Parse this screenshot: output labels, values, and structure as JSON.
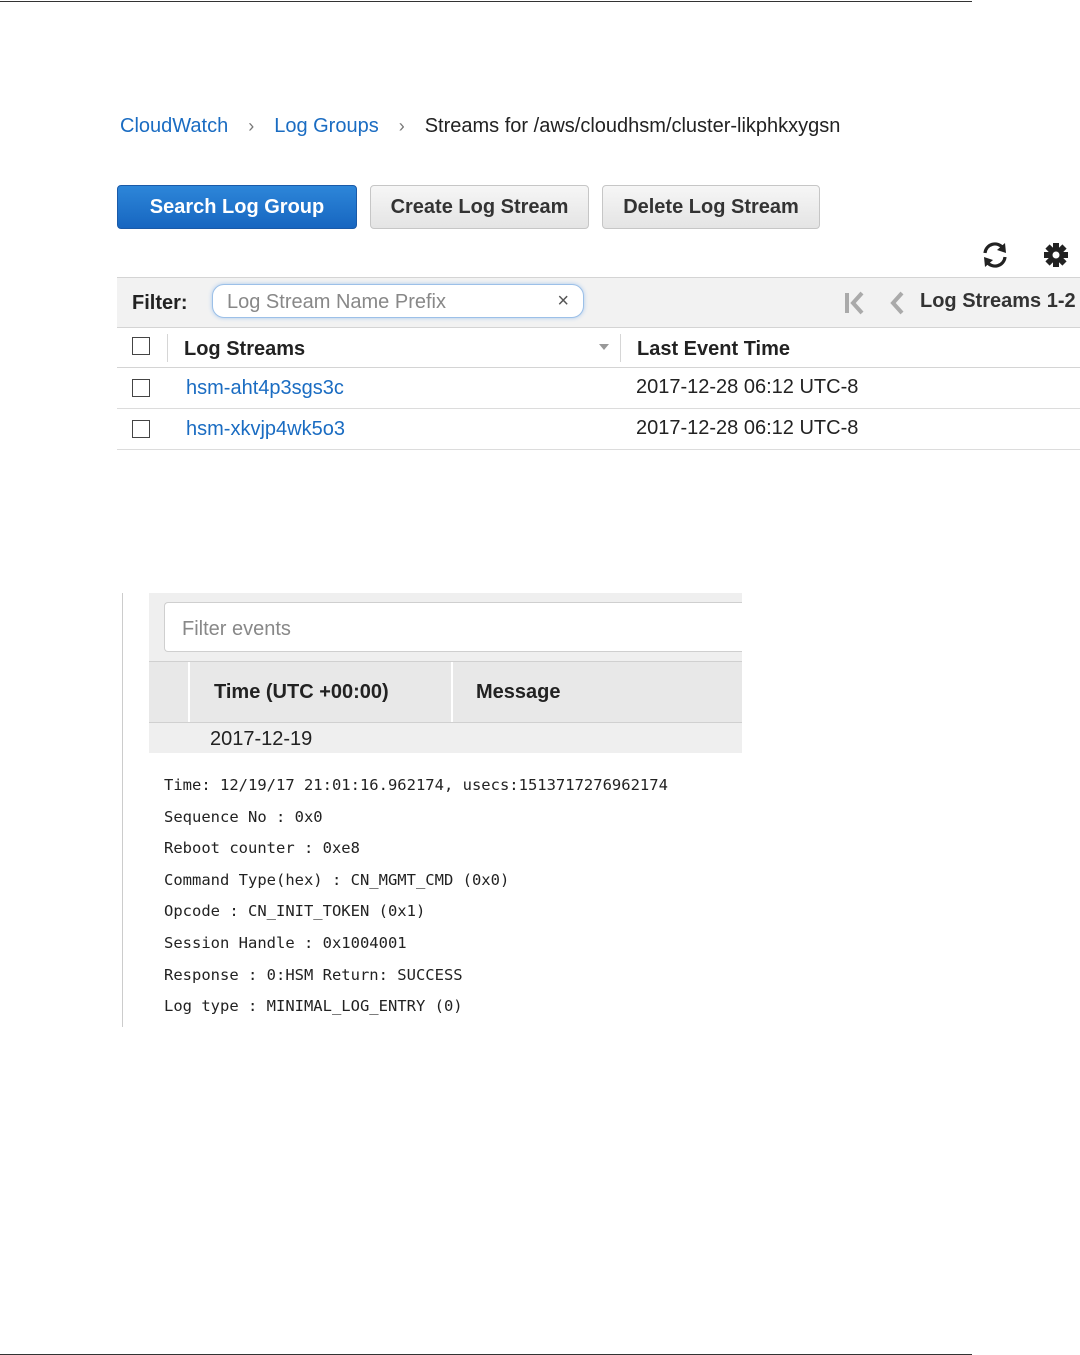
{
  "breadcrumb": {
    "items": [
      "CloudWatch",
      "Log Groups"
    ],
    "current": "Streams for /aws/cloudhsm/cluster-likphkxygsn",
    "separator": "›"
  },
  "toolbar": {
    "search_label": "Search Log Group",
    "create_label": "Create Log Stream",
    "delete_label": "Delete Log Stream",
    "refresh_icon": "refresh-icon",
    "settings_icon": "gear-icon"
  },
  "filter": {
    "label": "Filter:",
    "placeholder": "Log Stream Name Prefix",
    "clear": "×",
    "pager_text": "Log Streams 1-2"
  },
  "table": {
    "headers": [
      "Log Streams",
      "Last Event Time"
    ],
    "rows": [
      {
        "name": "hsm-aht4p3sgs3c",
        "time": "2017-12-28 06:12 UTC-8"
      },
      {
        "name": "hsm-xkvjp4wk5o3",
        "time": "2017-12-28 06:12 UTC-8"
      }
    ]
  },
  "events": {
    "placeholder": "Filter events",
    "headers": [
      "Time (UTC +00:00)",
      "Message"
    ],
    "date": "2017-12-19",
    "lines": [
      "Time: 12/19/17 21:01:16.962174, usecs:1513717276962174",
      "Sequence No : 0x0",
      "Reboot counter : 0xe8",
      "Command Type(hex) : CN_MGMT_CMD (0x0)",
      "Opcode : CN_INIT_TOKEN (0x1)",
      "Session Handle : 0x1004001",
      "Response : 0:HSM Return: SUCCESS",
      "Log type : MINIMAL_LOG_ENTRY (0)"
    ]
  },
  "colors": {
    "link": "#1a6cc2",
    "primary_button": "#1f74cc",
    "bar_background": "#f2f2f2"
  }
}
